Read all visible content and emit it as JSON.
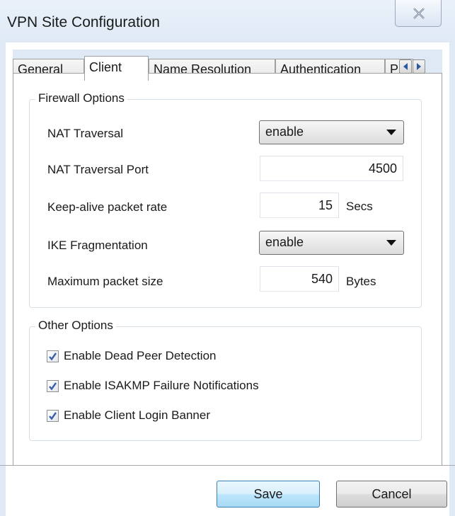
{
  "window": {
    "title": "VPN Site Configuration"
  },
  "tabs": [
    {
      "label": "General",
      "active": false
    },
    {
      "label": "Client",
      "active": true
    },
    {
      "label": "Name Resolution",
      "active": false
    },
    {
      "label": "Authentication",
      "active": false
    },
    {
      "label": "P",
      "active": false
    }
  ],
  "firewall": {
    "legend": "Firewall Options",
    "nat_traversal": {
      "label": "NAT Traversal",
      "value": "enable"
    },
    "nat_traversal_port": {
      "label": "NAT Traversal Port",
      "value": "4500"
    },
    "keepalive": {
      "label": "Keep-alive packet rate",
      "value": "15",
      "unit": "Secs"
    },
    "ike_fragmentation": {
      "label": "IKE Fragmentation",
      "value": "enable"
    },
    "max_packet": {
      "label": "Maximum packet size",
      "value": "540",
      "unit": "Bytes"
    }
  },
  "other": {
    "legend": "Other Options",
    "checks": [
      {
        "label": "Enable Dead Peer Detection",
        "checked": true
      },
      {
        "label": "Enable ISAKMP Failure Notifications",
        "checked": true
      },
      {
        "label": "Enable Client Login Banner",
        "checked": true
      }
    ]
  },
  "buttons": {
    "save": "Save",
    "cancel": "Cancel"
  },
  "colors": {
    "title_bg": "#dfe9f5",
    "check": "#3a5ea8",
    "primary_border": "#3c7fb1"
  },
  "icons": {
    "close": "close-icon",
    "scroll_left": "chevron-left-icon",
    "scroll_right": "chevron-right-icon",
    "dropdown": "chevron-down-icon",
    "check": "checkmark-icon"
  }
}
